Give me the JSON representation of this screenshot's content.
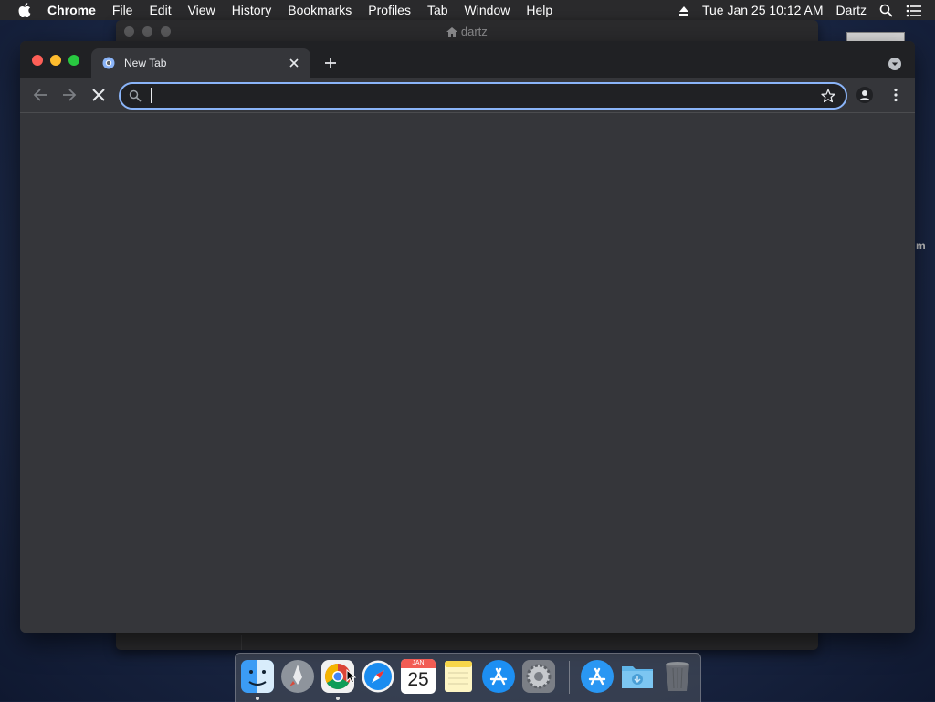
{
  "menubar": {
    "apple_icon": "apple-icon",
    "app_name": "Chrome",
    "items": [
      "File",
      "Edit",
      "View",
      "History",
      "Bookmarks",
      "Profiles",
      "Tab",
      "Window",
      "Help"
    ],
    "datetime": "Tue Jan 25  10:12 AM",
    "user": "Dartz"
  },
  "background_window": {
    "title": "dartz"
  },
  "browser": {
    "tab_title": "New Tab",
    "omnibox": {
      "value": "",
      "placeholder": ""
    }
  },
  "dock": {
    "calendar_month": "JAN",
    "calendar_day": "25",
    "apps": [
      "Finder",
      "Launchpad",
      "Google Chrome",
      "Safari",
      "Calendar",
      "Notes",
      "App Store",
      "System Preferences",
      "App Store",
      "Downloads",
      "Trash"
    ]
  },
  "colors": {
    "accent": "#8ab4f8",
    "tab_strip": "#202124",
    "toolbar": "#35363a",
    "close": "#fe5f57",
    "minimize": "#febc2e",
    "zoom": "#28c840"
  }
}
